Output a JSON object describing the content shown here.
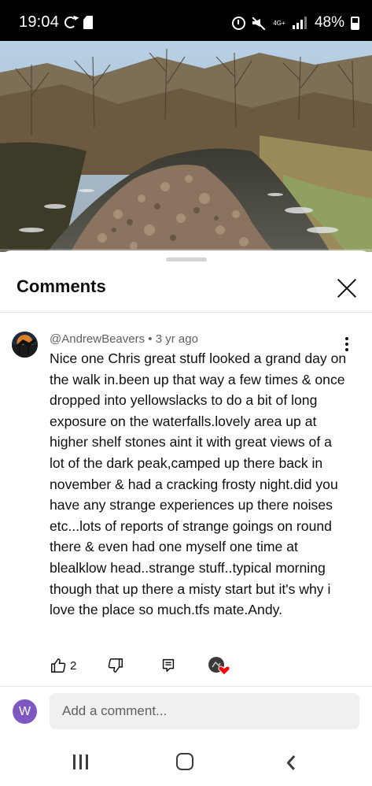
{
  "status_bar": {
    "time": "19:04",
    "network": "4G+",
    "battery_percent": "48%",
    "icons": [
      "sync-icon",
      "sd-card-icon",
      "alarm-icon",
      "mute-icon",
      "network-4g-icon",
      "signal-icon",
      "battery-icon"
    ]
  },
  "video": {
    "description_icon": "video-thumbnail",
    "progress": 0
  },
  "comments_panel": {
    "title": "Comments",
    "close_icon": "close-icon"
  },
  "comment": {
    "author": "@AndrewBeavers",
    "separator": "•",
    "age": "3 yr ago",
    "text": "Nice one Chris great stuff looked a grand day on the walk in.been up that way a few times & once dropped into yellowslacks to do a bit of long exposure on the waterfalls.lovely area up at higher shelf stones aint it with great views of a lot of the dark peak,camped up there back in november & had a cracking frosty night.did you have any strange experiences up there noises etc...lots of reports of strange goings on round there & even had one myself one time at blealklow head..strange stuff..typical morning though that up there a misty start but it's why i love the place so much.tfs mate.Andy.",
    "like_count": "2",
    "heart_color": "#ff0000"
  },
  "composer": {
    "user_initial": "W",
    "avatar_color": "#7e57c2",
    "placeholder": "Add a comment..."
  },
  "nav_bar": {
    "icons": [
      "recents-icon",
      "home-icon",
      "back-icon"
    ]
  }
}
